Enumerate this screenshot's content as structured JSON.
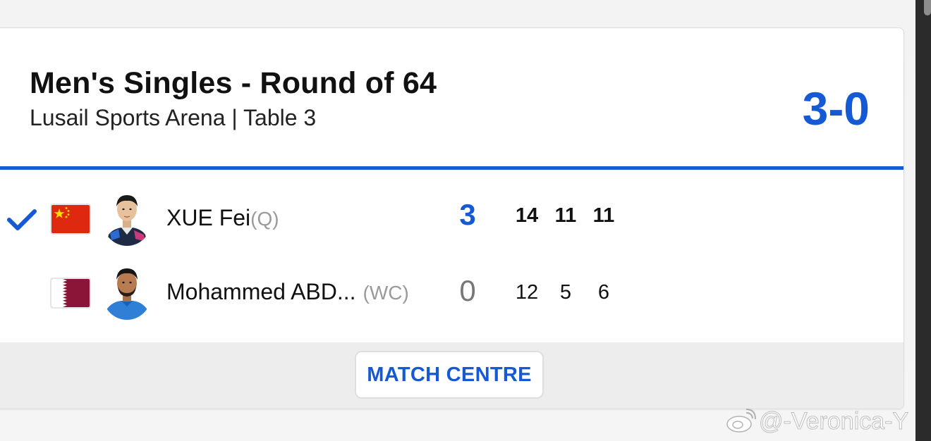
{
  "match": {
    "title": "Men's Singles - Round of 64",
    "venue": "Lusail Sports Arena | Table 3",
    "score": "3-0"
  },
  "players": [
    {
      "name": "XUE Fei",
      "tag": "(Q)",
      "country_flag": "china-flag",
      "games_won": "3",
      "sets": [
        "14",
        "11",
        "11"
      ],
      "winner": true
    },
    {
      "name": "Mohammed ABD...",
      "tag": "(WC)",
      "country_flag": "qatar-flag",
      "games_won": "0",
      "sets": [
        "12",
        "5",
        "6"
      ],
      "winner": false
    }
  ],
  "footer": {
    "match_centre_label": "MATCH CENTRE"
  },
  "watermark": {
    "text": "@-Veronica-Y"
  },
  "colors": {
    "accent_blue": "#1659d4",
    "china_red": "#de2910",
    "china_yellow": "#ffde00",
    "qatar_maroon": "#8a1538"
  }
}
